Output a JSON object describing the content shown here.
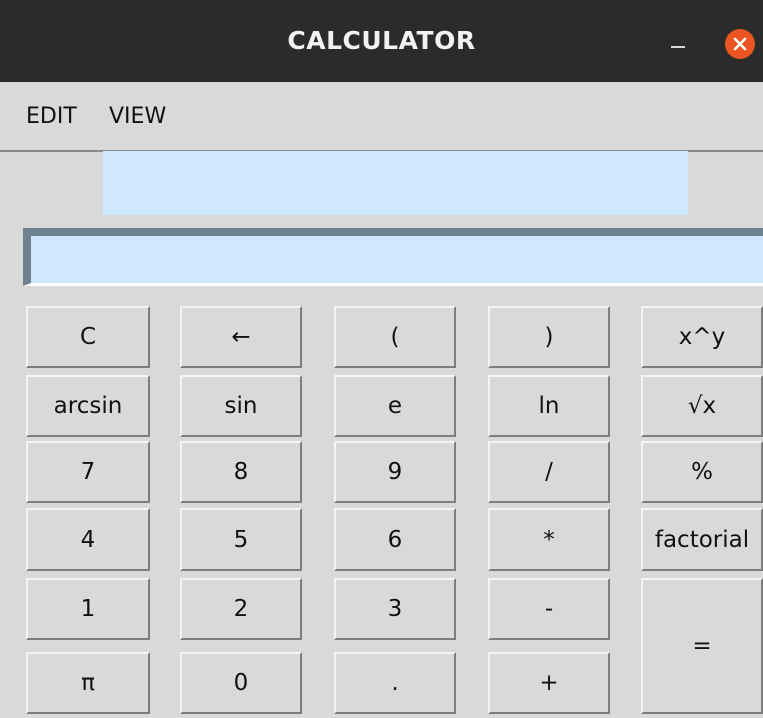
{
  "window": {
    "title": "CALCULATOR"
  },
  "menu": {
    "edit": "EDIT",
    "view": "VIEW"
  },
  "display": {
    "expression": "",
    "entry": ""
  },
  "keys": {
    "clear": "C",
    "backspace": "←",
    "lparen": "(",
    "rparen": ")",
    "power": "x^y",
    "arcsin": "arcsin",
    "sin": "sin",
    "e": "e",
    "ln": "ln",
    "sqrt": "√x",
    "seven": "7",
    "eight": "8",
    "nine": "9",
    "divide": "/",
    "percent": "%",
    "four": "4",
    "five": "5",
    "six": "6",
    "multiply": "*",
    "factorial": "factorial",
    "one": "1",
    "two": "2",
    "three": "3",
    "minus": "-",
    "equals": "=",
    "pi": "π",
    "zero": "0",
    "decimal": ".",
    "plus": "+"
  },
  "colors": {
    "titlebar": "#2b2b2b",
    "close_button": "#e95420",
    "display_bg": "#cfe8ff",
    "window_bg": "#d9d9d9"
  }
}
